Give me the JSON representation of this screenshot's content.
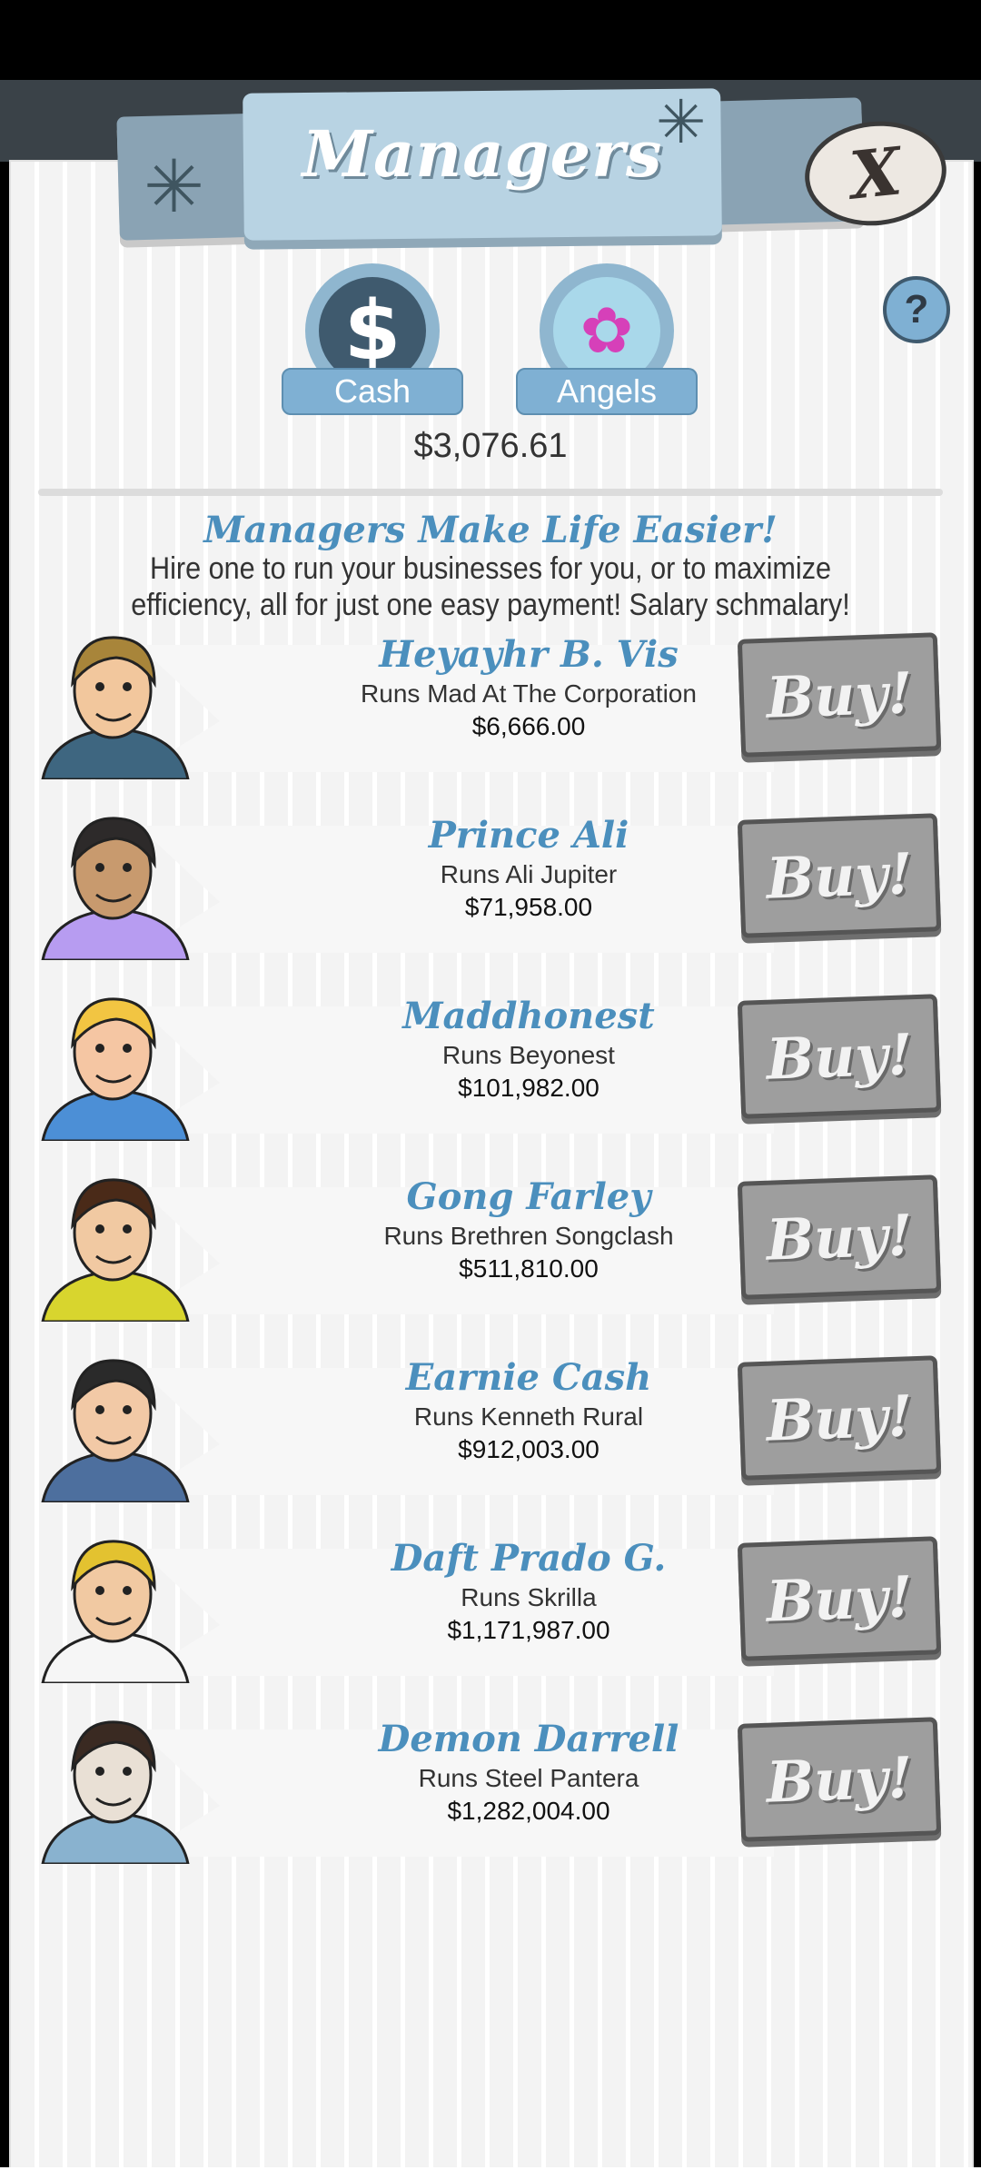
{
  "header": {
    "title": "Managers",
    "close_label": "X"
  },
  "tabs": [
    {
      "label": "Cash",
      "icon": "dollar-icon",
      "glyph": "$"
    },
    {
      "label": "Angels",
      "icon": "angel-icon",
      "glyph": "✿"
    }
  ],
  "help_label": "?",
  "cash_amount": "$3,076.61",
  "intro": {
    "headline": "Managers Make Life Easier!",
    "description": "Hire one to run your businesses for you, or to maximize efficiency, all for just one easy payment! Salary schmalary!"
  },
  "managers": [
    {
      "name": "Heyayhr B. Vis",
      "runs": "Runs Mad At The Corporation",
      "cost": "$6,666.00",
      "buy": "Buy!",
      "hair": "#a8853a",
      "skin": "#f2c79d",
      "shirt": "#3e6680"
    },
    {
      "name": "Prince Ali",
      "runs": "Runs Ali Jupiter",
      "cost": "$71,958.00",
      "buy": "Buy!",
      "hair": "#2d2a2a",
      "skin": "#c89a6e",
      "shirt": "#b79cf1"
    },
    {
      "name": "Maddhonest",
      "runs": "Runs Beyonest",
      "cost": "$101,982.00",
      "buy": "Buy!",
      "hair": "#f2c542",
      "skin": "#f5c6a3",
      "shirt": "#4c8fd6"
    },
    {
      "name": "Gong Farley",
      "runs": "Runs Brethren Songclash",
      "cost": "$511,810.00",
      "buy": "Buy!",
      "hair": "#4a2a18",
      "skin": "#f1c9a2",
      "shirt": "#d8d52e"
    },
    {
      "name": "Earnie Cash",
      "runs": "Runs Kenneth Rural",
      "cost": "$912,003.00",
      "buy": "Buy!",
      "hair": "#2a2a2a",
      "skin": "#f2c9a6",
      "shirt": "#4d6f9e"
    },
    {
      "name": "Daft Prado G.",
      "runs": "Runs Skrilla",
      "cost": "$1,171,987.00",
      "buy": "Buy!",
      "hair": "#e3c230",
      "skin": "#f1c9a2",
      "shirt": "#f6f6f6"
    },
    {
      "name": "Demon Darrell",
      "runs": "Runs Steel Pantera",
      "cost": "$1,282,004.00",
      "buy": "Buy!",
      "hair": "#3a2a22",
      "skin": "#e9e0d5",
      "shirt": "#89b2cf"
    }
  ]
}
